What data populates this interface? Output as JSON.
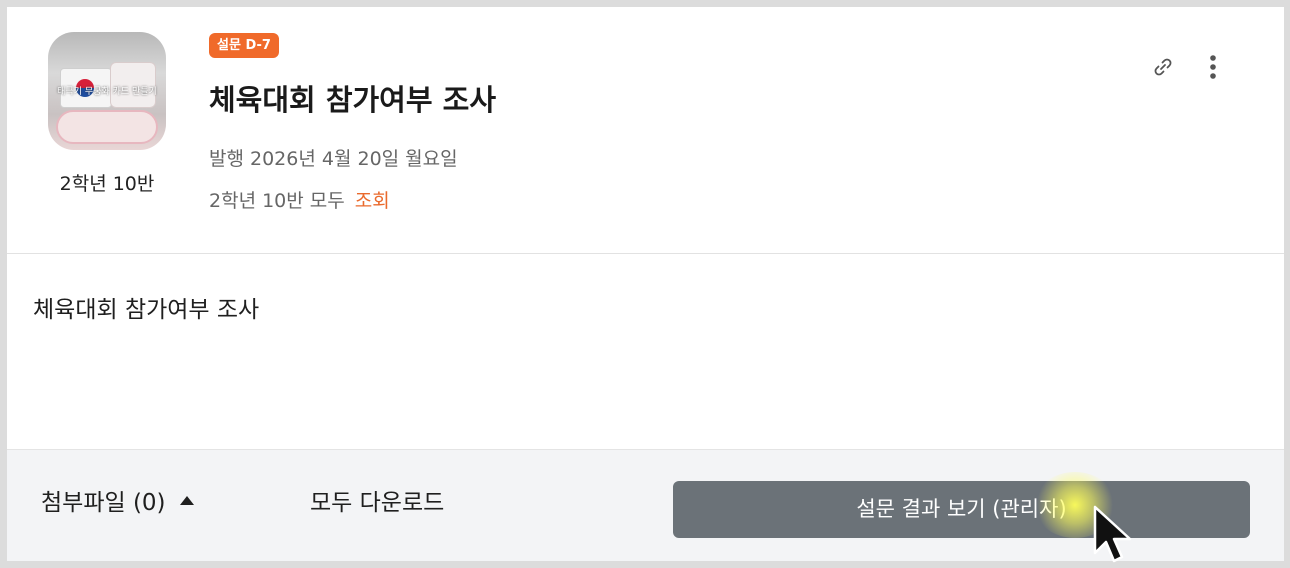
{
  "post": {
    "badge": "설문 D-7",
    "title": "체육대회 참가여부 조사",
    "class_name": "2학년 10반",
    "thumbnail_caption": "태극기 무궁화 카드 만들기",
    "published": "발행 2026년 4월 20일 월요일",
    "audience": "2학년 10반 모두",
    "view_label": "조회",
    "body": "체육대회 참가여부 조사"
  },
  "icons": {
    "link": "link-icon",
    "more": "more-vertical-icon",
    "attachment_toggle": "caret-up-icon",
    "cursor": "mouse-pointer-icon"
  },
  "footer": {
    "attachments_label": "첨부파일 (0)",
    "download_all_label": "모두 다운로드",
    "results_button_label": "설문 결과 보기 (관리자)"
  },
  "colors": {
    "badge": "#f06a2a",
    "view_link": "#ea6a2c",
    "results_button": "#6b7278",
    "footer_bg": "#f3f4f6"
  }
}
